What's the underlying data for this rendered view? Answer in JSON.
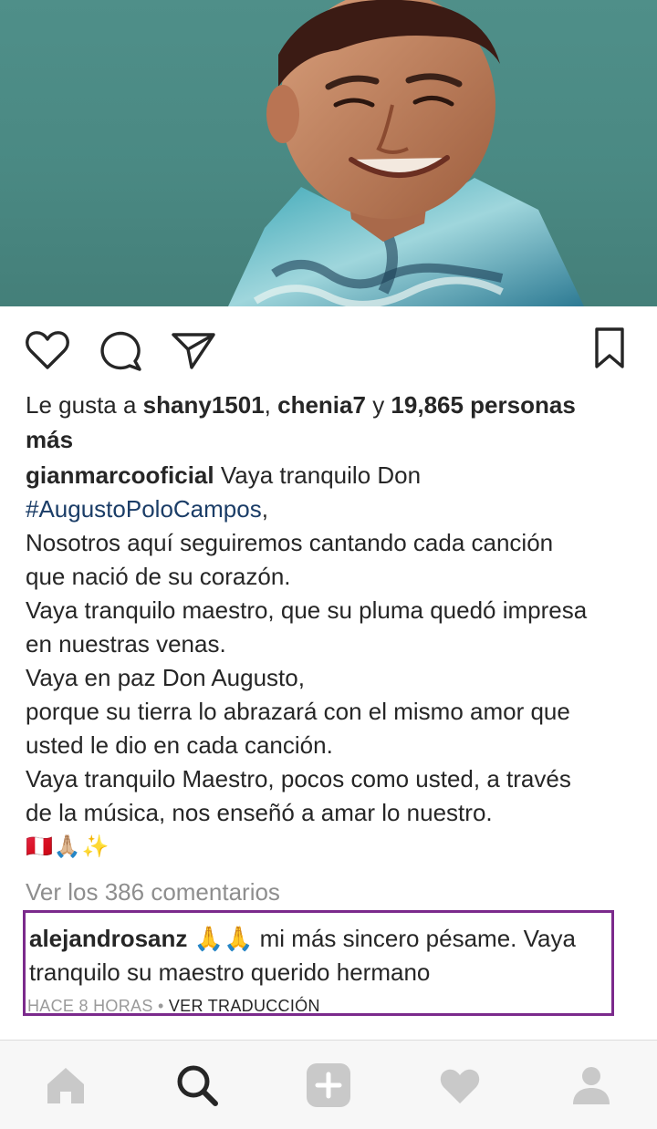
{
  "post": {
    "author": "gianmarcooficial",
    "likes": {
      "prefix": "Le gusta a",
      "user1": "shany1501",
      "sep": ",",
      "user2": "chenia7",
      "conj": "y",
      "count": "19,865 personas",
      "suffix": "más"
    },
    "caption": {
      "first": "Vaya tranquilo Don",
      "hashtag": "#AugustoPoloCampos",
      "hashtag_suffix": ",",
      "lines": [
        "Nosotros aquí seguiremos cantando cada canción",
        "que nació de su corazón.",
        "Vaya tranquilo maestro, que su pluma quedó impresa",
        "en nuestras venas.",
        "Vaya en paz Don Augusto,",
        "porque su tierra lo abrazará con el mismo amor que",
        "usted le dio en cada canción.",
        "Vaya tranquilo Maestro, pocos como usted, a través",
        "de la música, nos enseñó a amar lo nuestro."
      ],
      "emojis": "🇵🇪🙏🏼✨"
    },
    "view_comments": "Ver los 386 comentarios"
  },
  "comment": {
    "user": "alejandrosanz",
    "emojis": "🙏🙏",
    "text": "mi más sincero pésame. Vaya",
    "text2": "tranquilo su maestro querido hermano",
    "time": "HACE 8 HORAS",
    "dot": "•",
    "translate": "VER TRADUCCIÓN"
  },
  "actions": [
    "like-icon",
    "comment-icon",
    "share-icon",
    "bookmark-icon"
  ],
  "nav": [
    "home-icon",
    "search-icon",
    "add-icon",
    "heart-icon",
    "profile-icon"
  ],
  "colors": {
    "text": "#262626",
    "muted": "#8e8e8e",
    "hashtag": "#1b3d67",
    "highlight_border": "#7b2a8c",
    "nav_icon": "#c9c9c9",
    "nav_active": "#262626"
  }
}
